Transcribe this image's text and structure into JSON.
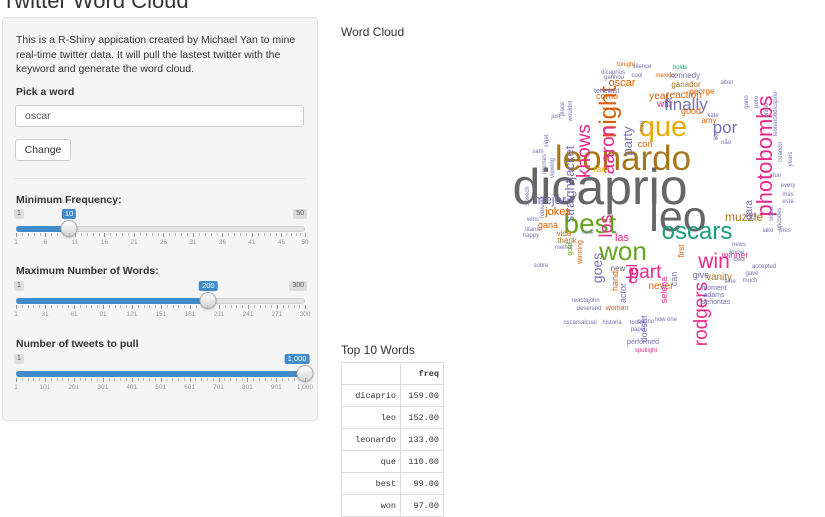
{
  "app": {
    "title": "Twitter Word Cloud"
  },
  "sidebar": {
    "intro": "This is a R-Shiny appication created by Michael Yan to mine real-time twitter data. It will pull the lastest twitter with the keyword and generate the word cloud.",
    "pick_label": "Pick a word",
    "word_input": "oscar",
    "change_button": "Change",
    "sliders": [
      {
        "label": "Minimum Frequency:",
        "min": 1,
        "max": 50,
        "value": 10,
        "min_text": "1",
        "max_text": "50",
        "value_text": "10",
        "major_ticks": [
          1,
          6,
          11,
          16,
          21,
          26,
          31,
          36,
          41,
          46,
          50
        ],
        "tick_labels": [
          "1",
          "6",
          "11",
          "16",
          "21",
          "26",
          "31",
          "36",
          "41",
          "46",
          "50"
        ]
      },
      {
        "label": "Maximum Number of Words:",
        "min": 1,
        "max": 300,
        "value": 200,
        "min_text": "1",
        "max_text": "300",
        "value_text": "200",
        "major_ticks": [
          1,
          31,
          61,
          91,
          121,
          151,
          181,
          211,
          241,
          271,
          300
        ],
        "tick_labels": [
          "1",
          "31",
          "61",
          "91",
          "121",
          "151",
          "181",
          "211",
          "241",
          "271",
          "300"
        ]
      },
      {
        "label": "Number of tweets to pull",
        "min": 1,
        "max": 1000,
        "value": 1000,
        "min_text": "1",
        "max_text": "",
        "value_text": "1,000",
        "major_ticks": [
          1,
          101,
          201,
          301,
          401,
          501,
          601,
          701,
          801,
          901,
          1000
        ],
        "tick_labels": [
          "1",
          "101",
          "201",
          "301",
          "401",
          "501",
          "601",
          "701",
          "801",
          "901",
          "1,000"
        ]
      }
    ]
  },
  "main": {
    "wordcloud_title": "Word Cloud",
    "top_title": "Top 10 Words",
    "table": {
      "headers": [
        "",
        "freq"
      ],
      "rows": [
        {
          "word": "dicaprio",
          "freq": "159.00"
        },
        {
          "word": "leo",
          "freq": "152.00"
        },
        {
          "word": "leonardo",
          "freq": "133.00"
        },
        {
          "word": "que",
          "freq": "110.00"
        },
        {
          "word": "best",
          "freq": "99.00"
        },
        {
          "word": "won",
          "freq": "97.00"
        }
      ]
    }
  },
  "wordcloud": {
    "colors": {
      "gray": "#666666",
      "brown": "#a6761d",
      "pink": "#e7298a",
      "purple": "#7570b3",
      "orange": "#d95f02",
      "teal": "#1b9e77",
      "green": "#66a61e",
      "gold": "#e6ab02"
    },
    "words": [
      {
        "text": "dicaprio",
        "color": "gray"
      },
      {
        "text": "leo",
        "color": "gray"
      },
      {
        "text": "leonardo",
        "color": "brown"
      },
      {
        "text": "que",
        "color": "gold"
      },
      {
        "text": "best",
        "color": "green"
      },
      {
        "text": "won",
        "color": "green"
      },
      {
        "text": "oscars",
        "color": "teal"
      },
      {
        "text": "photobombs",
        "color": "pink"
      },
      {
        "text": "night",
        "color": "orange"
      },
      {
        "text": "aaron",
        "color": "pink"
      },
      {
        "text": "knows",
        "color": "pink"
      },
      {
        "text": "rodgers",
        "color": "pink"
      },
      {
        "text": "finally",
        "color": "purple"
      },
      {
        "text": "part",
        "color": "pink"
      },
      {
        "text": "win",
        "color": "pink"
      },
      {
        "text": "los",
        "color": "pink"
      },
      {
        "text": "mejor",
        "color": "purple"
      },
      {
        "text": "por",
        "color": "purple"
      },
      {
        "text": "straightjacket",
        "color": "purple"
      },
      {
        "text": "goes",
        "color": "purple"
      },
      {
        "text": "jokes",
        "color": "orange"
      },
      {
        "text": "party",
        "color": "purple"
      },
      {
        "text": "muzzle",
        "color": "brown"
      },
      {
        "text": "del",
        "color": "pink"
      },
      {
        "text": "para",
        "color": "purple"
      },
      {
        "text": "las",
        "color": "pink"
      },
      {
        "text": "oscar",
        "color": "orange"
      },
      {
        "text": "year",
        "color": "orange"
      },
      {
        "text": "reaction",
        "color": "orange"
      },
      {
        "text": "will",
        "color": "pink"
      },
      {
        "text": "como",
        "color": "orange"
      },
      {
        "text": "vanity",
        "color": "brown"
      },
      {
        "text": "winner",
        "color": "pink"
      },
      {
        "text": "never",
        "color": "orange"
      },
      {
        "text": "gana",
        "color": "orange"
      },
      {
        "text": "give",
        "color": "purple"
      },
      {
        "text": "fair",
        "color": "gold"
      },
      {
        "text": "thank",
        "color": "brown"
      },
      {
        "text": "amy",
        "color": "orange"
      },
      {
        "text": "con",
        "color": "orange"
      },
      {
        "text": "first",
        "color": "orange"
      },
      {
        "text": "actor",
        "color": "purple"
      },
      {
        "text": "hand",
        "color": "orange"
      },
      {
        "text": "selena",
        "color": "pink"
      },
      {
        "text": "can",
        "color": "purple"
      },
      {
        "text": "doesnt",
        "color": "purple"
      },
      {
        "text": "good",
        "color": "orange"
      },
      {
        "text": "vida",
        "color": "orange"
      },
      {
        "text": "new",
        "color": "gray"
      },
      {
        "text": "george",
        "color": "orange"
      },
      {
        "text": "ganador",
        "color": "brown"
      },
      {
        "text": "kennedy",
        "color": "purple"
      },
      {
        "text": "silence",
        "color": "purple"
      },
      {
        "text": "mexico",
        "color": "orange"
      },
      {
        "text": "ganhou",
        "color": "purple"
      },
      {
        "text": "cool",
        "color": "purple"
      },
      {
        "text": "holds",
        "color": "teal"
      },
      {
        "text": "tonight",
        "color": "orange"
      },
      {
        "text": "dicaprios",
        "color": "purple"
      },
      {
        "text": "tener",
        "color": "purple"
      },
      {
        "text": "last",
        "color": "purple"
      },
      {
        "text": "moment",
        "color": "purple"
      },
      {
        "text": "adams",
        "color": "purple"
      },
      {
        "text": "señoritas",
        "color": "purple"
      },
      {
        "text": "performed",
        "color": "purple"
      },
      {
        "text": "spotlight",
        "color": "pink"
      },
      {
        "text": "caprio",
        "color": "purple"
      },
      {
        "text": "papel",
        "color": "purple"
      },
      {
        "text": "today",
        "color": "purple"
      },
      {
        "text": "historia",
        "color": "purple"
      },
      {
        "text": "oscarsalcual",
        "color": "purple"
      },
      {
        "text": "deserved",
        "color": "purple"
      },
      {
        "text": "woman",
        "color": "orange"
      },
      {
        "text": "reacta",
        "color": "purple"
      },
      {
        "text": "john",
        "color": "purple"
      },
      {
        "text": "melhor",
        "color": "purple"
      },
      {
        "text": "titanic",
        "color": "purple"
      },
      {
        "text": "happy",
        "color": "purple"
      },
      {
        "text": "sobre",
        "color": "purple"
      },
      {
        "text": "wins",
        "color": "purple"
      },
      {
        "text": "winning",
        "color": "orange"
      },
      {
        "text": "gold",
        "color": "green"
      },
      {
        "text": "rose",
        "color": "purple"
      },
      {
        "text": "fun",
        "color": "purple"
      },
      {
        "text": "every",
        "color": "purple"
      },
      {
        "text": "más",
        "color": "purple"
      },
      {
        "text": "este",
        "color": "purple"
      },
      {
        "text": "years",
        "color": "purple"
      },
      {
        "text": "cuando",
        "color": "purple"
      },
      {
        "text": "primo",
        "color": "purple"
      },
      {
        "text": "gano",
        "color": "purple"
      },
      {
        "text": "pero",
        "color": "purple"
      },
      {
        "text": "alton",
        "color": "purple"
      },
      {
        "text": "leonardodicaprio",
        "color": "purple"
      },
      {
        "text": "kate",
        "color": "purple"
      },
      {
        "text": "like",
        "color": "purple"
      },
      {
        "text": "não",
        "color": "purple"
      },
      {
        "text": "com",
        "color": "purple"
      },
      {
        "text": "accepted",
        "color": "purple"
      },
      {
        "text": "gave",
        "color": "purple"
      },
      {
        "text": "much",
        "color": "purple"
      },
      {
        "text": "time",
        "color": "purple"
      },
      {
        "text": "news",
        "color": "purple"
      },
      {
        "text": "know",
        "color": "purple"
      },
      {
        "text": "died",
        "color": "purple"
      },
      {
        "text": "pres",
        "color": "purple"
      },
      {
        "text": "lake",
        "color": "purple"
      },
      {
        "text": "speech",
        "color": "purple"
      },
      {
        "text": "memes",
        "color": "purple"
      },
      {
        "text": "viewing",
        "color": "purple"
      },
      {
        "text": "sam",
        "color": "purple"
      },
      {
        "text": "siget",
        "color": "purple"
      },
      {
        "text": "february",
        "color": "purple"
      },
      {
        "text": "place",
        "color": "purple"
      },
      {
        "text": "wouldnt",
        "color": "purple"
      },
      {
        "text": "just",
        "color": "purple"
      },
      {
        "text": "ford",
        "color": "purple"
      },
      {
        "text": "one",
        "color": "purple"
      },
      {
        "text": "now",
        "color": "purple"
      },
      {
        "text": "sides",
        "color": "purple"
      },
      {
        "text": "upcodes",
        "color": "purple"
      }
    ]
  }
}
